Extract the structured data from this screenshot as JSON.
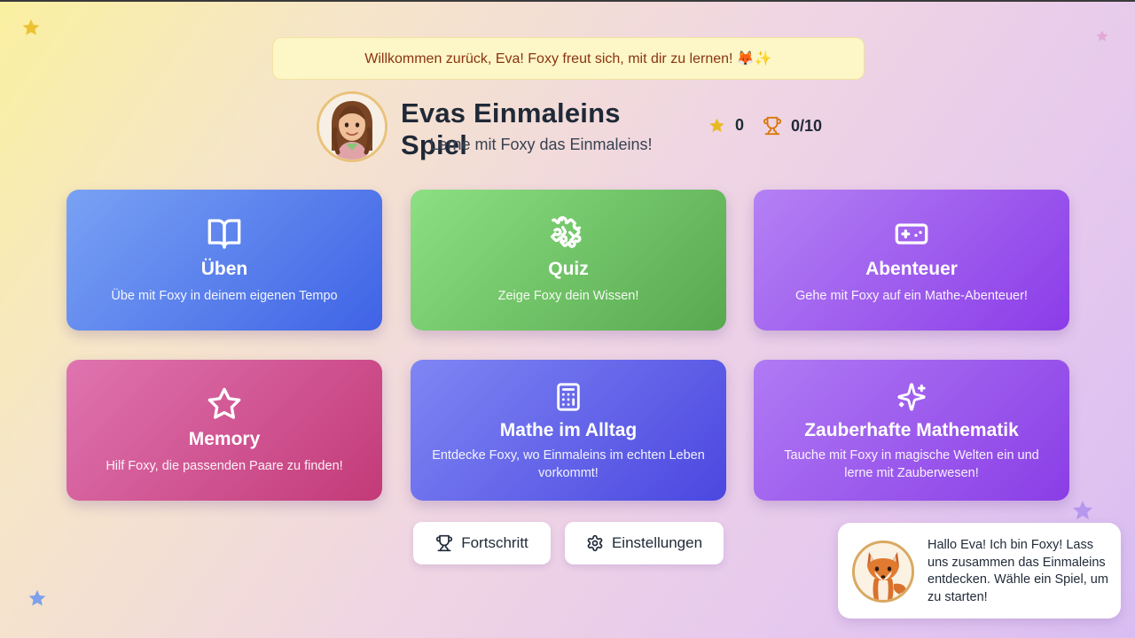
{
  "welcome": {
    "message": "Willkommen zurück, Eva! Foxy freut sich, mit dir zu lernen! 🦊✨"
  },
  "header": {
    "title": "Evas Einmaleins Spiel",
    "subtitle": "Lerne mit Foxy das Einmaleins!",
    "stars_count": "0",
    "trophy_progress": "0/10"
  },
  "cards": [
    {
      "title": "Üben",
      "description": "Übe mit Foxy in deinem eigenen Tempo",
      "icon": "book-open-icon"
    },
    {
      "title": "Quiz",
      "description": "Zeige Foxy dein Wissen!",
      "icon": "puzzle-icon"
    },
    {
      "title": "Abenteuer",
      "description": "Gehe mit Foxy auf ein Mathe-Abenteuer!",
      "icon": "gamepad-icon"
    },
    {
      "title": "Memory",
      "description": "Hilf Foxy, die passenden Paare zu finden!",
      "icon": "star-icon"
    },
    {
      "title": "Mathe im Alltag",
      "description": "Entdecke Foxy, wo Einmaleins im echten Leben vorkommt!",
      "icon": "calculator-icon"
    },
    {
      "title": "Zauberhafte Mathematik",
      "description": "Tauche mit Foxy in magische Welten ein und lerne mit Zauberwesen!",
      "icon": "sparkles-icon"
    }
  ],
  "buttons": {
    "progress_label": "Fortschritt",
    "settings_label": "Einstellungen"
  },
  "foxy": {
    "message": "Hallo Eva! Ich bin Foxy! Lass uns zusammen das Einmaleins entdecken. Wähle ein Spiel, um zu starten!"
  },
  "colors": {
    "star_yellow": "#e8b923",
    "trophy_orange": "#d97706",
    "card_blue": "#4f6fe8",
    "card_green": "#62b25a",
    "card_purple": "#9a4ff0",
    "card_pink": "#cc4a88",
    "card_indigo": "#5a58e4"
  }
}
